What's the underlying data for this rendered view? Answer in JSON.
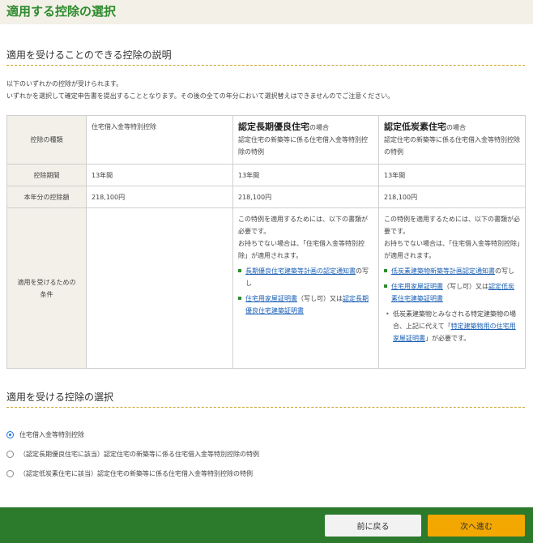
{
  "page": {
    "title": "適用する控除の選択"
  },
  "explain": {
    "heading": "適用を受けることのできる控除の説明",
    "line1": "以下のいずれかの控除が受けられます。",
    "line2": "いずれかを選択して確定申告書を提出することとなります。その後の全ての年分において選択替えはできませんのでご注意ください。"
  },
  "table": {
    "row_headers": {
      "type": "控除の種類",
      "period": "控除期間",
      "amount": "本年分の控除額",
      "condition": "適用を受けるための条件"
    },
    "col1": {
      "name": "住宅借入金等特別控除",
      "period": "13年間",
      "amount": "218,100円"
    },
    "col2": {
      "name_big": "認定長期優良住宅",
      "name_suffix": "の場合",
      "subtitle": "認定住宅の新築等に係る住宅借入金等特別控除の特例",
      "period": "13年間",
      "amount": "218,100円",
      "cond_intro": "この特例を適用するためには、以下の書類が必要です。",
      "cond_fallback": "お持ちでない場合は、「住宅借入金等特別控除」が適用されます。",
      "link1": "長期優良住宅建築等計画の認定通知書",
      "link1_after": "の写し",
      "link2": "住宅用家屋証明書",
      "link2_mid": "（写し可）又は",
      "link3": "認定長期優良住宅建築証明書"
    },
    "col3": {
      "name_big": "認定低炭素住宅",
      "name_suffix": "の場合",
      "subtitle": "認定住宅の新築等に係る住宅借入金等特別控除の特例",
      "period": "13年間",
      "amount": "218,100円",
      "cond_intro": "この特例を適用するためには、以下の書類が必要です。",
      "cond_fallback": "お持ちでない場合は、「住宅借入金等特別控除」が適用されます。",
      "link1": "低炭素建築物新築等計画認定通知書",
      "link1_after": "の写し",
      "link2": "住宅用家屋証明書",
      "link2_mid": "（写し可）又は",
      "link3": "認定低炭素住宅建築証明書",
      "note_before": "低炭素建築物とみなされる特定建築物の場合、上記に代えて「",
      "note_link": "特定建築物用の住宅用家屋証明書",
      "note_after": "」が必要です。"
    }
  },
  "select": {
    "heading": "適用を受ける控除の選択",
    "options": [
      {
        "label": "住宅借入金等特別控除",
        "checked": true
      },
      {
        "label": "（認定長期優良住宅に該当）認定住宅の新築等に係る住宅借入金等特別控除の特例",
        "checked": false
      },
      {
        "label": "（認定低炭素住宅に該当）認定住宅の新築等に係る住宅借入金等特別控除の特例",
        "checked": false
      }
    ]
  },
  "footer": {
    "back_label": "前に戻る",
    "next_label": "次へ進む"
  },
  "colors": {
    "brand_green": "#2c7a2c",
    "title_green": "#2e8b2e",
    "next_button": "#f2a800",
    "link": "#1a5fb4"
  }
}
